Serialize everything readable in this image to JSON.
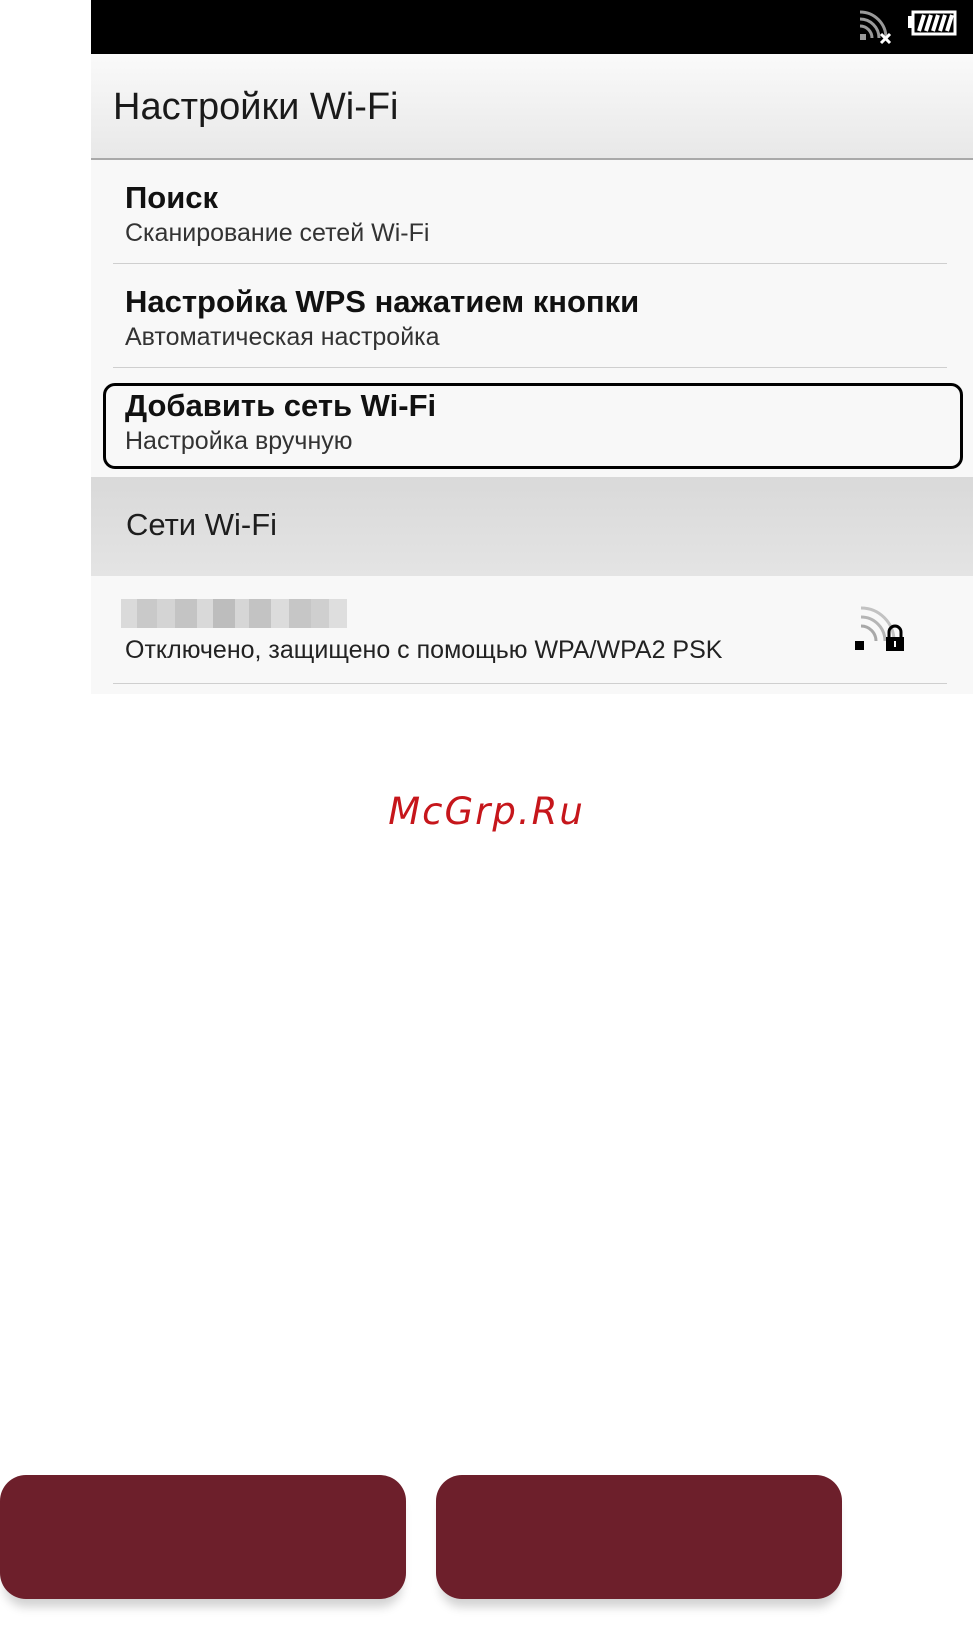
{
  "title_bar": {
    "title": "Настройки Wi-Fi"
  },
  "status_bar": {
    "icons": [
      "wifi-disconnected-icon",
      "battery-icon"
    ]
  },
  "menu": {
    "items": [
      {
        "title": "Поиск",
        "subtitle": "Сканирование сетей Wi-Fi"
      },
      {
        "title": "Настройка WPS нажатием кнопки",
        "subtitle": "Автоматическая настройка"
      },
      {
        "title": "Добавить сеть Wi-Fi",
        "subtitle": "Настройка вручную",
        "highlighted": true
      }
    ]
  },
  "networks_section": {
    "header": "Сети Wi-Fi",
    "networks": [
      {
        "status": "Отключено, защищено с помощью WPA/WPA2 PSK",
        "icon": "wifi-locked-icon"
      }
    ]
  },
  "watermark": {
    "text": "McGrp.Ru"
  },
  "colors": {
    "button": "#6d1f2b",
    "watermark": "#c6161b",
    "status_bar": "#000000",
    "highlight_border": "#000000"
  }
}
